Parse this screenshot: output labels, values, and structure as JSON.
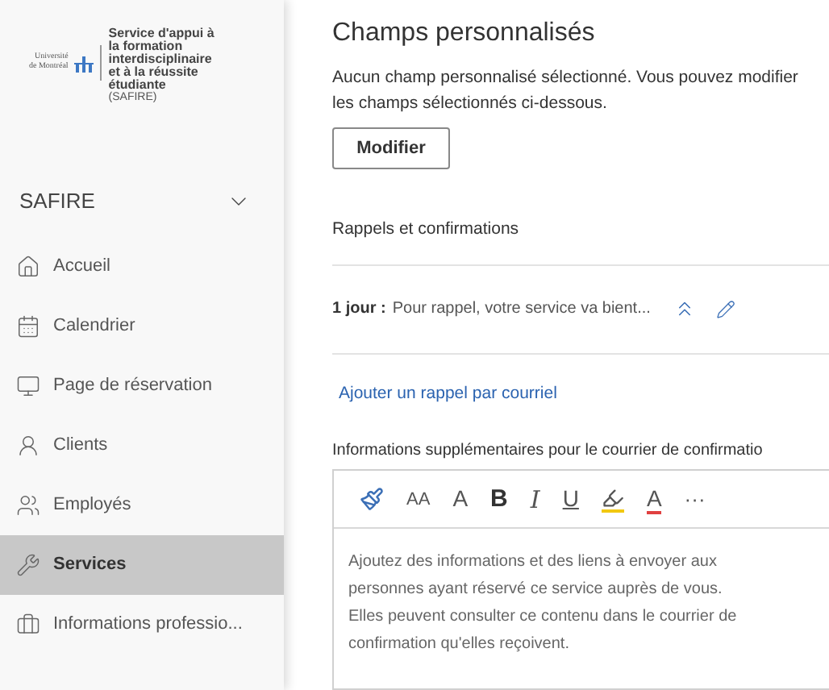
{
  "sidebar": {
    "logo": {
      "university_line_1": "Université",
      "university_line_2": "de Montréal",
      "service": "Service d'appui à la formation interdisciplinaire et à la réussite étudiante",
      "acronym": "(SAFIRE)"
    },
    "business": {
      "name": "SAFIRE",
      "expanded": false
    },
    "items": [
      {
        "label": "Accueil",
        "kind": "home",
        "selected": false
      },
      {
        "label": "Calendrier",
        "kind": "calendar",
        "selected": false
      },
      {
        "label": "Page de réservation",
        "kind": "monitor",
        "selected": false
      },
      {
        "label": "Clients",
        "kind": "client",
        "selected": false
      },
      {
        "label": "Employés",
        "kind": "staff",
        "selected": false
      },
      {
        "label": "Services",
        "kind": "wrench",
        "selected": true
      },
      {
        "label": "Informations professio...",
        "kind": "briefcase",
        "selected": false
      }
    ]
  },
  "main": {
    "title": "Champs personnalisés",
    "description_lines": [
      "Aucun champ personnalisé sélectionné. Vous pouvez modifier",
      "les champs sélectionnés ci-dessous."
    ],
    "modify_button": "Modifier",
    "reminders_heading": "Rappels et confirmations",
    "reminders": [
      {
        "delay": "1 jour :",
        "message": "Pour rappel, votre service va bient..."
      }
    ],
    "add_reminder_link": "Ajouter un rappel par courriel",
    "editor_label": "Informations supplémentaires pour le courrier de confirmatio",
    "toolbar": [
      {
        "kind": "brush"
      },
      {
        "kind": "fontsize",
        "text": "AA"
      },
      {
        "kind": "superscript",
        "text": "A"
      },
      {
        "kind": "bold",
        "text": "B"
      },
      {
        "kind": "italic",
        "text": "I"
      },
      {
        "kind": "underline",
        "text": "U"
      },
      {
        "kind": "highlighter"
      },
      {
        "kind": "fontcolor",
        "text": "A"
      },
      {
        "kind": "more",
        "text": "···"
      }
    ],
    "editor_placeholder": "Ajoutez des informations et des liens à envoyer aux personnes ayant réservé ce service auprès de vous. Elles peuvent consulter ce contenu dans le courrier de confirmation qu'elles reçoivent."
  }
}
